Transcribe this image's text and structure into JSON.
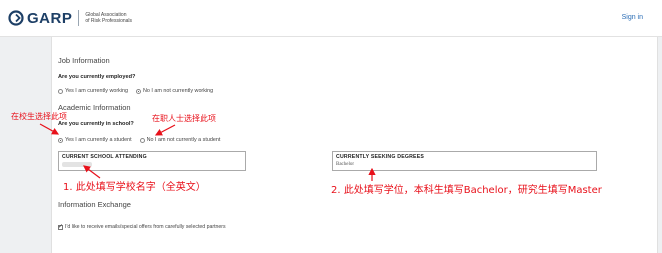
{
  "header": {
    "logo_text": "GARP",
    "logo_sub_line1": "Global Association",
    "logo_sub_line2": "of Risk Professionals",
    "signin_label": "Sign in"
  },
  "job": {
    "section_title": "Job Information",
    "question": "Are you currently employed?",
    "options": [
      {
        "label": "Yes I am currently working",
        "checked": false
      },
      {
        "label": "No I am not currently working",
        "checked": true
      }
    ]
  },
  "academic": {
    "section_title": "Academic Information",
    "question": "Are you currently in school?",
    "options": [
      {
        "label": "Yes I am currently a student",
        "checked": true
      },
      {
        "label": "No I am not currently a student",
        "checked": false
      }
    ],
    "school_field_label": "CURRENT SCHOOL ATTENDING",
    "degree_field_label": "CURRENTLY SEEKING DEGREES",
    "degree_field_value": "Bachelor"
  },
  "exchange": {
    "section_title": "Information Exchange",
    "checkbox_label": "I'd like to receive emails/special offers from carefully selected partners",
    "checked": true
  },
  "annotations": {
    "student_choice": "在校生选择此项",
    "worker_choice": "在职人士选择此项",
    "school_note": "1. 此处填写学校名字（全英文）",
    "degree_note": "2. 此处填写学位，本科生填写Bachelor，研究生填写Master",
    "color": "#e8101a"
  }
}
